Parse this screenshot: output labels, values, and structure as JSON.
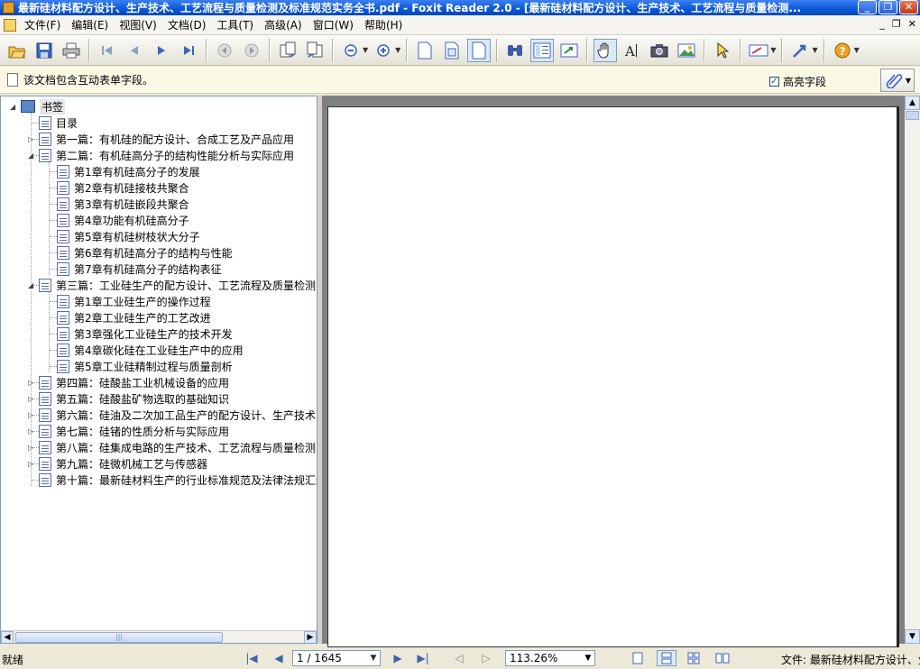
{
  "window": {
    "title": "最新硅材料配方设计、生产技术、工艺流程与质量检测及标准规范实务全书.pdf - Foxit Reader 2.0 - [最新硅材料配方设计、生产技术、工艺流程与质量检测...",
    "minimize_label": "_",
    "restore_label": "❐",
    "close_label": "✕"
  },
  "menu": {
    "items": [
      "文件(F)",
      "编辑(E)",
      "视图(V)",
      "文档(D)",
      "工具(T)",
      "高级(A)",
      "窗口(W)",
      "帮助(H)"
    ],
    "mdi_min": "_",
    "mdi_restore": "❐",
    "mdi_close": "✕"
  },
  "toolbar": {
    "icons": [
      "open-icon",
      "save-icon",
      "print-icon",
      "first-page-icon",
      "prev-page-icon",
      "next-page-icon",
      "last-page-icon",
      "back-icon",
      "forward-icon",
      "rotate-left-icon",
      "rotate-right-icon",
      "zoom-out-icon",
      "zoom-in-icon",
      "single-page-icon",
      "continuous-icon",
      "fit-page-icon",
      "find-icon",
      "bookmark-pane-icon",
      "fit-width-icon",
      "hand-tool-icon",
      "text-select-icon",
      "snapshot-icon",
      "image-icon",
      "select-tool-icon",
      "typewriter-icon",
      "annotation-icon",
      "help-icon"
    ]
  },
  "infobar": {
    "message": "该文档包含互动表单字段。",
    "highlight_label": "高亮字段",
    "highlight_checked": true
  },
  "bookmarks": {
    "root": "书签",
    "items": [
      {
        "label": "目录",
        "level": 1,
        "expander": ""
      },
      {
        "label": "第一篇：有机硅的配方设计、合成工艺及产品应用",
        "level": 1,
        "expander": "▷"
      },
      {
        "label": "第二篇：有机硅高分子的结构性能分析与实际应用",
        "level": 1,
        "expander": "◢"
      },
      {
        "label": "第1章有机硅高分子的发展",
        "level": 2,
        "expander": ""
      },
      {
        "label": "第2章有机硅接枝共聚合",
        "level": 2,
        "expander": ""
      },
      {
        "label": "第3章有机硅嵌段共聚合",
        "level": 2,
        "expander": ""
      },
      {
        "label": "第4章功能有机硅高分子",
        "level": 2,
        "expander": ""
      },
      {
        "label": "第5章有机硅树枝状大分子",
        "level": 2,
        "expander": ""
      },
      {
        "label": "第6章有机硅高分子的结构与性能",
        "level": 2,
        "expander": ""
      },
      {
        "label": "第7章有机硅高分子的结构表征",
        "level": 2,
        "expander": ""
      },
      {
        "label": "第三篇：工业硅生产的配方设计、工艺流程及质量检测",
        "level": 1,
        "expander": "◢"
      },
      {
        "label": "第1章工业硅生产的操作过程",
        "level": 2,
        "expander": ""
      },
      {
        "label": "第2章工业硅生产的工艺改进",
        "level": 2,
        "expander": ""
      },
      {
        "label": "第3章强化工业硅生产的技术开发",
        "level": 2,
        "expander": ""
      },
      {
        "label": "第4章碳化硅在工业硅生产中的应用",
        "level": 2,
        "expander": ""
      },
      {
        "label": "第5章工业硅精制过程与质量剖析",
        "level": 2,
        "expander": ""
      },
      {
        "label": "第四篇：硅酸盐工业机械设备的应用",
        "level": 1,
        "expander": "▷"
      },
      {
        "label": "第五篇：硅酸盐矿物选取的基础知识",
        "level": 1,
        "expander": "▷"
      },
      {
        "label": "第六篇：硅油及二次加工品生产的配方设计、生产技术",
        "level": 1,
        "expander": "▷"
      },
      {
        "label": "第七篇：硅锗的性质分析与实际应用",
        "level": 1,
        "expander": "▷"
      },
      {
        "label": "第八篇：硅集成电路的生产技术、工艺流程与质量检测",
        "level": 1,
        "expander": "▷"
      },
      {
        "label": "第九篇：硅微机械工艺与传感器",
        "level": 1,
        "expander": "▷"
      },
      {
        "label": "第十篇：最新硅材料生产的行业标准规范及法律法规汇编",
        "level": 1,
        "expander": ""
      }
    ],
    "scroll_left": "◀",
    "scroll_right": "▶",
    "thumb_grip": "|||"
  },
  "viewer": {
    "scroll_up": "▲",
    "scroll_down": "▼"
  },
  "status": {
    "ready": "就绪",
    "page_display": "1 / 1645",
    "zoom": "113.26%",
    "file_info": "文件: 最新硅材料配方设计、生产技术",
    "first": "|◀",
    "prev": "◀",
    "next": "▶",
    "last": "▶|",
    "back": "◁",
    "forward": "▷",
    "dropdown": "▼"
  }
}
